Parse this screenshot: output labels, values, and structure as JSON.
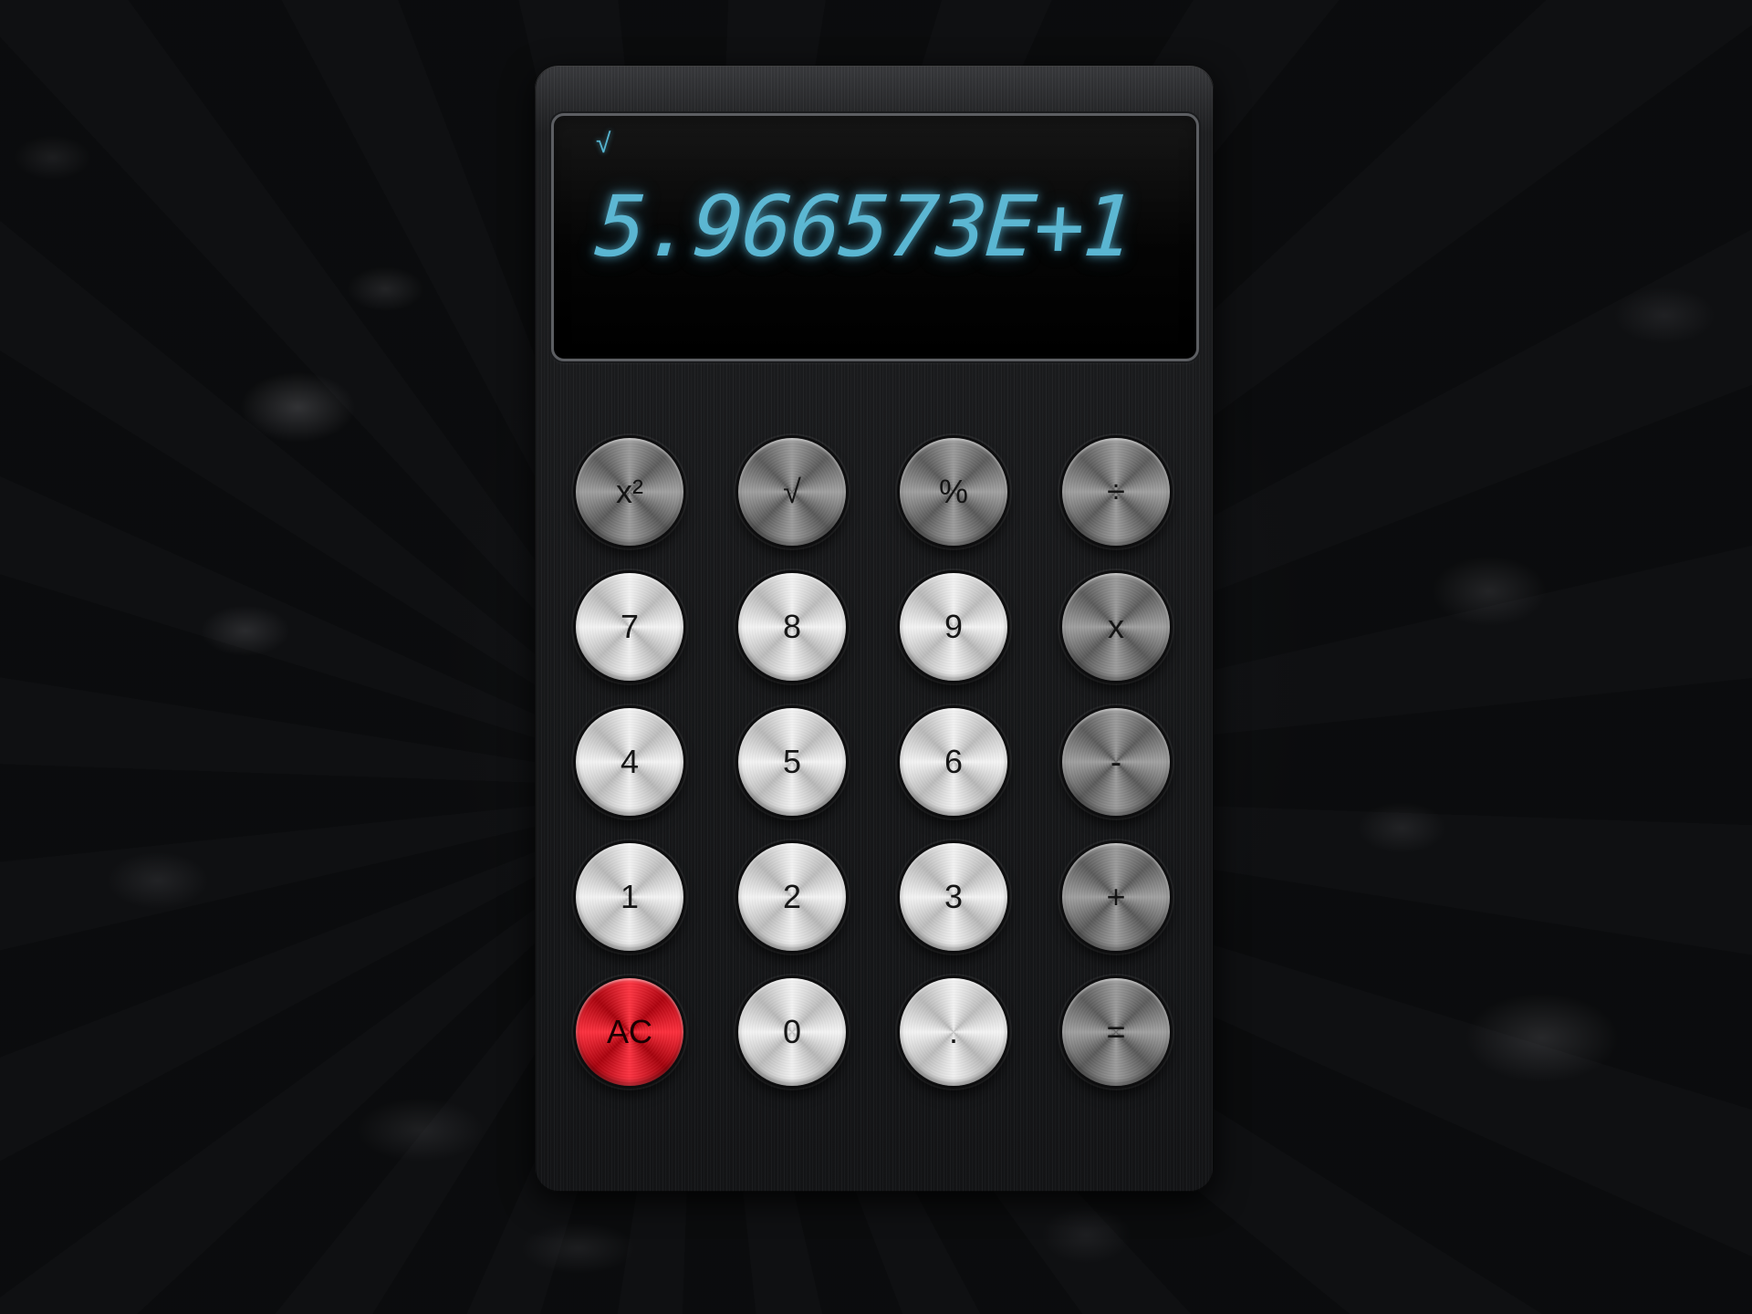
{
  "display": {
    "operator_indicator": "√",
    "value": "5.966573E+1",
    "text_color": "#5ab6d2"
  },
  "keys": {
    "square": "x²",
    "sqrt": "√",
    "percent": "%",
    "divide": "÷",
    "seven": "7",
    "eight": "8",
    "nine": "9",
    "multiply": "x",
    "four": "4",
    "five": "5",
    "six": "6",
    "subtract": "-",
    "one": "1",
    "two": "2",
    "three": "3",
    "add": "+",
    "clear": "AC",
    "zero": "0",
    "decimal": ".",
    "equals": "="
  },
  "colors": {
    "clear_key": "#e0101e",
    "digit_keys": "#e6e6e6",
    "function_keys": "#8a8a8a",
    "body": "#1b1c1e"
  }
}
